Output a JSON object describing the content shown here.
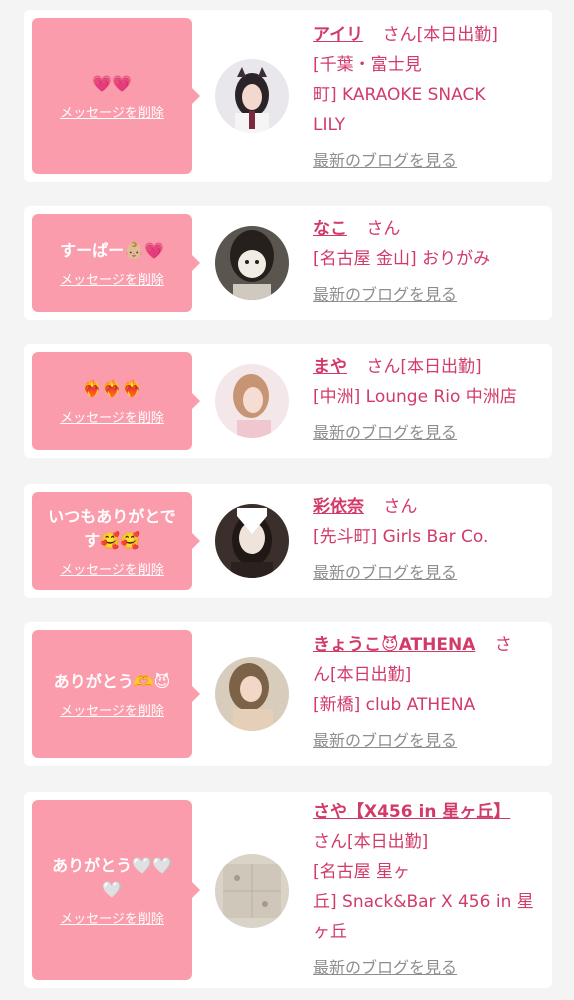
{
  "delete_label": "メッセージを削除",
  "blog_label": "最新のブログを見る",
  "cards": [
    {
      "message": "💗💗",
      "name": "アイリ",
      "honorific": "さん",
      "status": "[本日出勤]",
      "shop_line1": "[千葉・富士見",
      "shop_line2": "町] KARAOKE SNACK",
      "shop_line3": "LILY"
    },
    {
      "message": "すーぱー👶🏼💗",
      "name": "なこ",
      "honorific": "さん",
      "shop_line1": "[名古屋 金山] おりがみ"
    },
    {
      "message": "❤️‍🔥❤️‍🔥❤️‍🔥",
      "name": "まや",
      "honorific": "さん",
      "status": "[本日出勤]",
      "shop_line1": "[中洲] Lounge Rio 中洲店"
    },
    {
      "message_line1": "いつもありがとで",
      "message_line2": "す🥰🥰",
      "name": "彩依奈",
      "honorific": "さん",
      "shop_line1": "[先斗町] Girls Bar Co."
    },
    {
      "message": "ありがとう🫶😈",
      "name": "きょうこ😈ATHENA",
      "honorific_part1": "さ",
      "honorific_part2": "ん",
      "status": "[本日出勤]",
      "shop_line1": "[新橋] club ATHENA"
    },
    {
      "message_line1": "ありがとう🤍🤍",
      "message_line2": "🤍",
      "name": "さや【X456 in 星ヶ丘】",
      "honorific": "さん",
      "status": "[本日出勤]",
      "shop_line1": "[名古屋 星ヶ",
      "shop_line2": "丘] Snack&Bar X 456 in 星",
      "shop_line3": "ヶ丘"
    }
  ]
}
